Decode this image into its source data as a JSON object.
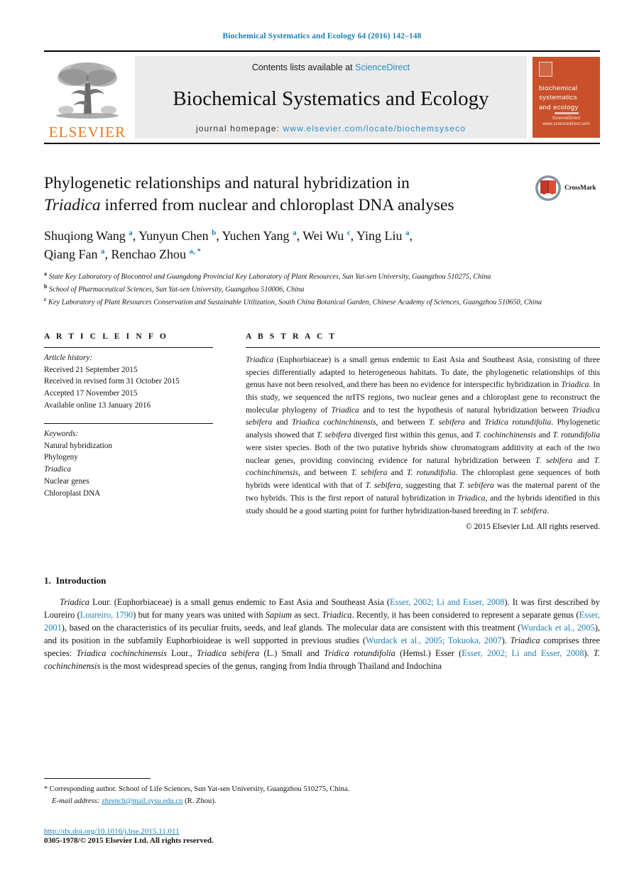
{
  "running_head": "Biochemical Systematics and Ecology 64 (2016) 142–148",
  "masthead": {
    "publisher_name": "ELSEVIER",
    "contents_prefix": "Contents lists available at ",
    "contents_link": "ScienceDirect",
    "journal_name": "Biochemical Systematics and Ecology",
    "homepage_prefix": "journal homepage: ",
    "homepage_url": "www.elsevier.com/locate/biochemsyseco",
    "cover": {
      "line1": "biochemical",
      "line2": "systematics",
      "line3": "and ecology",
      "foot1": "ScienceDirect",
      "foot2": "www.sciencedirect.com",
      "bg_color": "#C8502A"
    }
  },
  "article": {
    "title_line1": "Phylogenetic relationships and natural hybridization in",
    "title_italic": "Triadica",
    "title_line2_rest": " inferred from nuclear and chloroplast DNA analyses",
    "crossmark_label": "CrossMark",
    "authors": [
      {
        "name": "Shuqiong Wang",
        "sup": "a"
      },
      {
        "name": "Yunyun Chen",
        "sup": "b"
      },
      {
        "name": "Yuchen Yang",
        "sup": "a"
      },
      {
        "name": "Wei Wu",
        "sup": "c"
      },
      {
        "name": "Ying Liu",
        "sup": "a"
      },
      {
        "name": "Qiang Fan",
        "sup": "a"
      },
      {
        "name": "Renchao Zhou",
        "sup": "a, *"
      }
    ],
    "affiliations": [
      {
        "mark": "a",
        "text": "State Key Laboratory of Biocontrol and Guangdong Provincial Key Laboratory of Plant Resources, Sun Yat-sen University, Guangzhou 510275, China"
      },
      {
        "mark": "b",
        "text": "School of Pharmaceutical Sciences, Sun Yat-sen University, Guangzhou 510006, China"
      },
      {
        "mark": "c",
        "text": "Key Laboratory of Plant Resources Conservation and Sustainable Utilization, South China Botanical Garden, Chinese Academy of Sciences, Guangzhou 510650, China"
      }
    ]
  },
  "article_info": {
    "heading": "A R T I C L E  I N F O",
    "history_label": "Article history:",
    "history": [
      "Received 21 September 2015",
      "Received in revised form 31 October 2015",
      "Accepted 17 November 2015",
      "Available online 13 January 2016"
    ],
    "keywords_label": "Keywords:",
    "keywords": [
      "Natural hybridization",
      "Phylogeny",
      "Triadica",
      "Nuclear genes",
      "Chloroplast DNA"
    ]
  },
  "abstract": {
    "heading": "A B S T R A C T",
    "copyright": "© 2015 Elsevier Ltd. All rights reserved."
  },
  "introduction": {
    "number": "1.",
    "heading": "Introduction"
  },
  "footer": {
    "corresponding_star": "*",
    "corresponding_text": "Corresponding author. School of Life Sciences, Sun Yat-sen University, Guangzhou 510275, China.",
    "email_label": "E-mail address:",
    "email": "zhrench@mail.sysu.edu.cn",
    "email_owner": "(R. Zhou).",
    "doi": "http://dx.doi.org/10.1016/j.bse.2015.11.011",
    "issn": "0305-1978/© 2015 Elsevier Ltd. All rights reserved."
  },
  "colors": {
    "link_blue": "#1a7fb5",
    "elsevier_orange": "#E87722",
    "cover_orange": "#C8502A"
  }
}
